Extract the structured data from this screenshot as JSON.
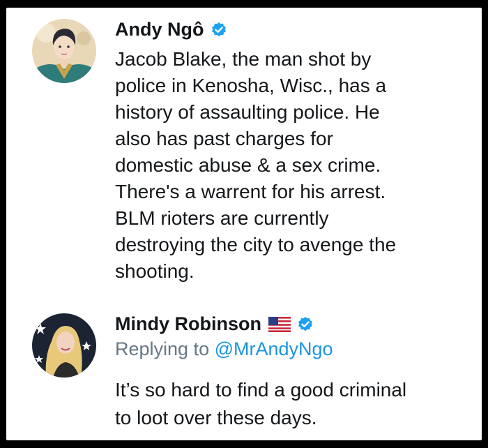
{
  "tweet1": {
    "display_name": "Andy Ngô",
    "lines": [
      "Jacob Blake, the man shot by",
      "police in Kenosha, Wisc., has a",
      "history of assaulting police. He",
      "also has past charges for",
      "domestic abuse & a sex crime.",
      "There's a warrent for his arrest.",
      "BLM rioters are currently",
      "destroying the city to avenge the",
      "shooting."
    ]
  },
  "tweet2": {
    "display_name": "Mindy Robinson",
    "flag_icon": "us-flag-icon",
    "reply_prefix": "Replying to",
    "reply_handle": "@MrAndyNgo",
    "lines": [
      "It’s so hard to find a good criminal",
      "to loot over these days."
    ]
  },
  "colors": {
    "verified": "#1da1f2",
    "mention": "#1b95e0",
    "muted": "#657786",
    "text": "#14171a"
  }
}
